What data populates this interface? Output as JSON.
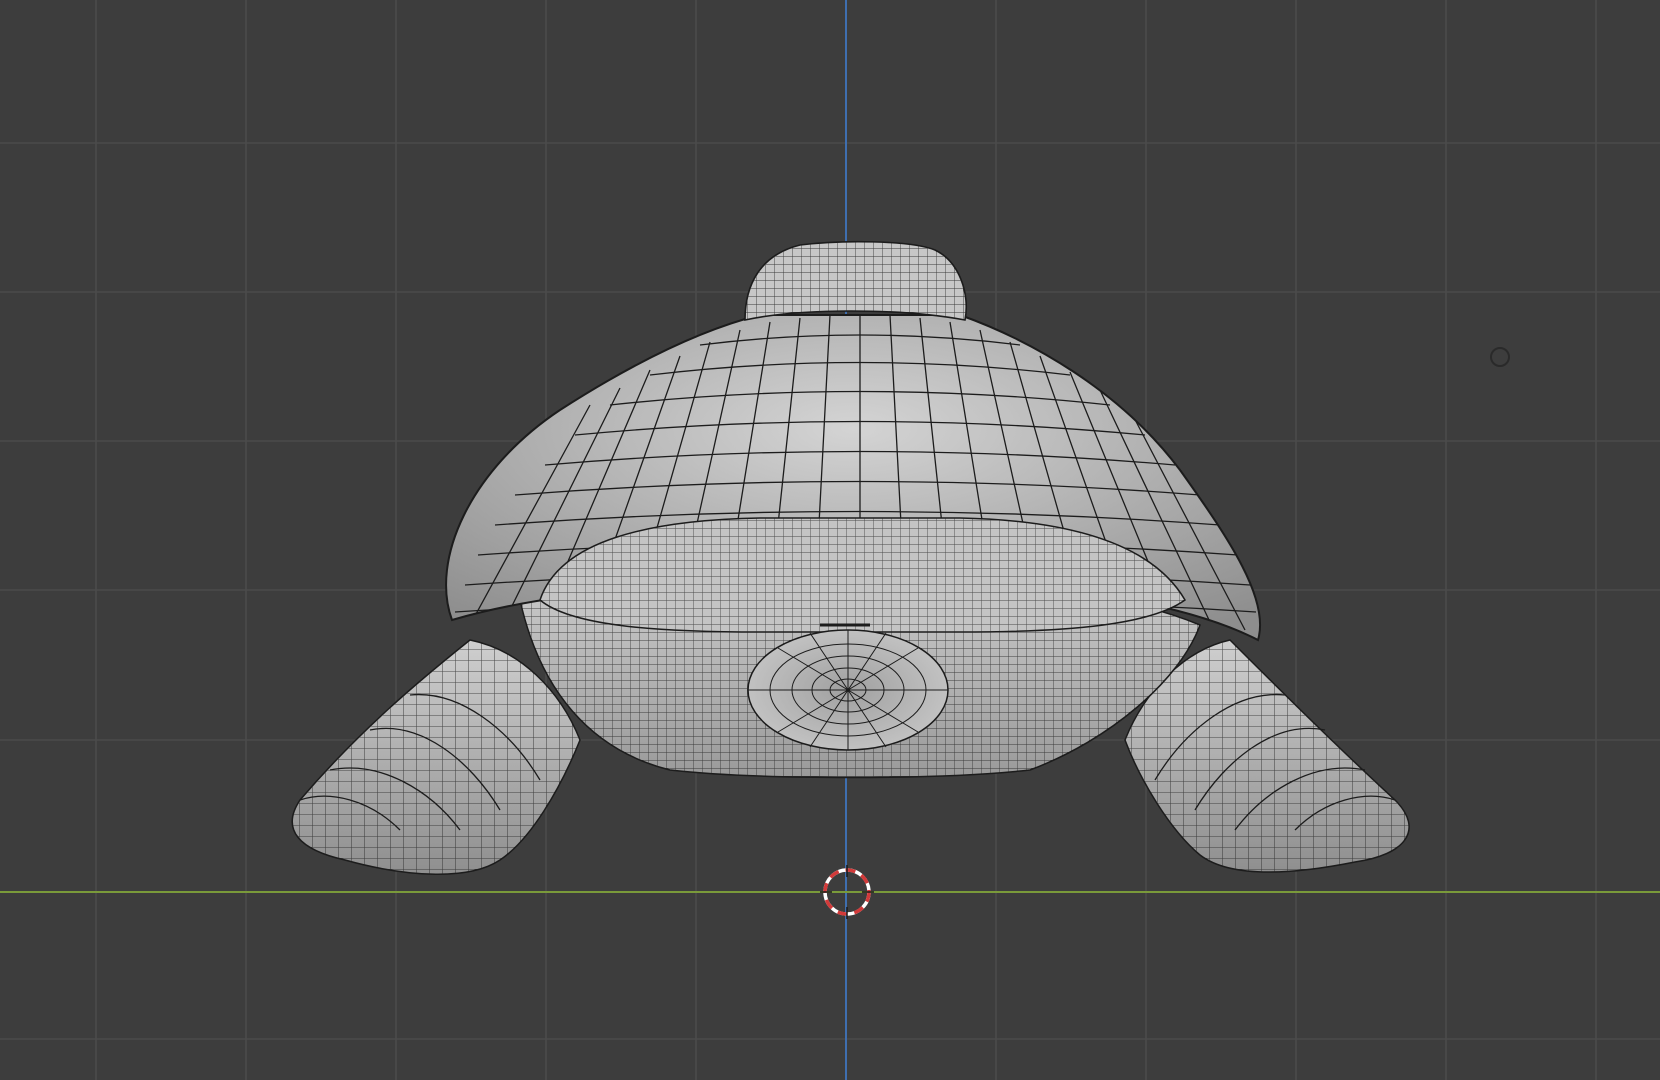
{
  "viewport": {
    "view": "3d-viewport",
    "shading": "solid-with-wireframe",
    "object": "turtle-mesh",
    "colors": {
      "background": "#3d3d3d",
      "grid_line": "#4b4b4b",
      "x_axis": "#7a9a3a",
      "z_axis": "#3f6fb0",
      "mesh_surface": "#bdbdbd",
      "mesh_wire": "#1c1c1c",
      "cursor_ring": "#d23a3a"
    },
    "icons": {
      "cursor": "3d-cursor-icon",
      "light": "light-source-icon"
    }
  }
}
